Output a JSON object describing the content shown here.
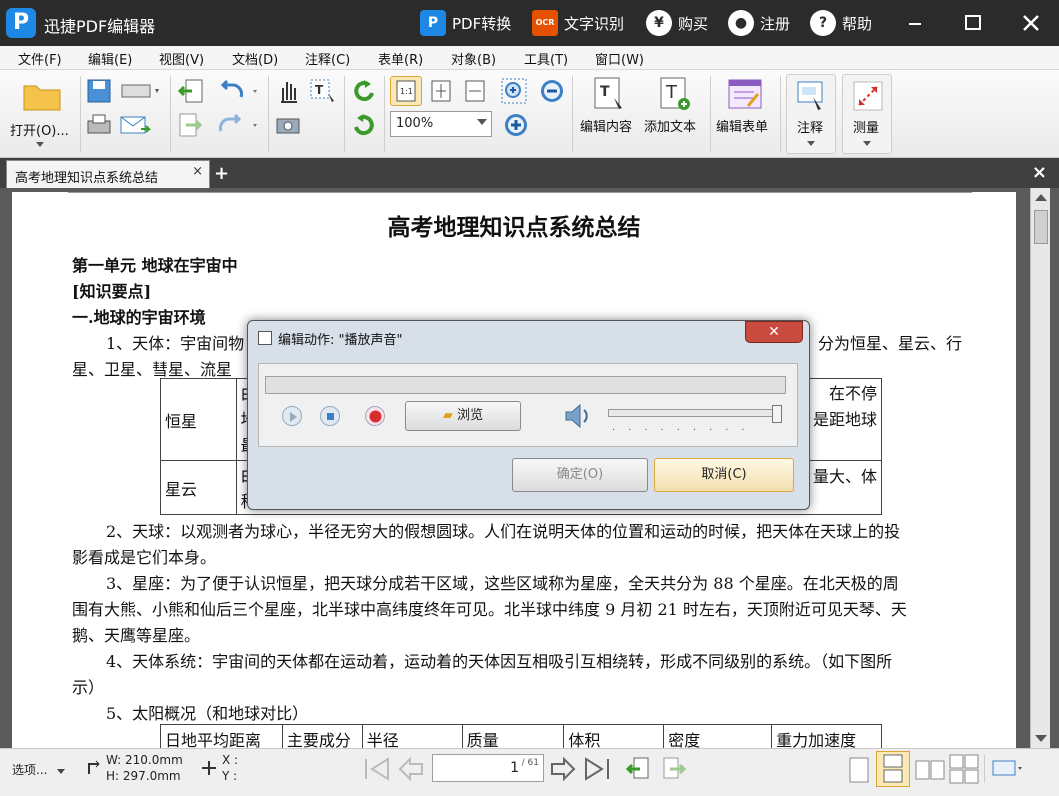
{
  "app": {
    "title": "迅捷PDF编辑器",
    "logo": "P"
  },
  "titlebar": {
    "pdf_convert": "PDF转换",
    "ocr": "文字识别",
    "ocr_badge": "OCR",
    "buy": "购买",
    "buy_icon": "¥",
    "register": "注册",
    "help": "帮助",
    "help_icon": "?"
  },
  "menu": [
    "文件(F)",
    "编辑(E)",
    "视图(V)",
    "文档(D)",
    "注释(C)",
    "表单(R)",
    "对象(B)",
    "工具(T)",
    "窗口(W)"
  ],
  "toolbar": {
    "open": "打开(O)...",
    "zoom": "100%",
    "edit_content": "编辑内容",
    "add_text": "添加文本",
    "edit_form": "编辑表单",
    "annotate": "注释",
    "measure": "测量"
  },
  "tab": {
    "label": "高考地理知识点系统总结",
    "close": "×",
    "add": "+",
    "viewer_close": "×"
  },
  "page": {
    "title": "高考地理知识点系统总结",
    "unit": "第一单元  地球在宇宙中",
    "key_points": "[知识要点]",
    "section": "一.地球的宇宙环境",
    "p1_start": "1、天体：宇宙间物",
    "p1_end": "分为恒星、星云、行",
    "p1_line2": "星、卫星、彗星、流星",
    "table1": {
      "row1_label": "恒星",
      "row1_left": [
        "由",
        "地",
        "最"
      ],
      "row1_right": [
        "在不停",
        "是距地球"
      ],
      "row2_label": "星云",
      "row2_left": [
        "由",
        "称"
      ],
      "row2_right": "量大、体"
    },
    "p2": "2、天球：以观测者为球心，半径无穷大的假想圆球。人们在说明天体的位置和运动的时候，把天体在天球上的投",
    "p2_line2": "影看成是它们本身。",
    "p3": "3、星座：为了便于认识恒星，把天球分成若干区域，这些区域称为星座，全天共分为 88 个星座。在北天极的周",
    "p3_line2": "围有大熊、小熊和仙后三个星座，北半球中高纬度终年可见。北半球中纬度 9 月初 21 时左右，天顶附近可见天琴、天",
    "p3_line3": "鹅、天鹰等星座。",
    "p4": "4、天体系统：宇宙间的天体都在运动着，运动着的天体因互相吸引互相绕转，形成不同级别的系统。（如下图所",
    "p4_line2": "示）",
    "p5": "5、太阳概况（和地球对比）",
    "table2_headers": [
      "日地平均距离",
      "主要成分",
      "半径",
      "质量",
      "体积",
      "密度",
      "重力加速度"
    ]
  },
  "dialog": {
    "title": "编辑动作: \"播放声音\"",
    "browse": "浏览",
    "ok": "确定(O)",
    "cancel": "取消(C)",
    "volume_level": 1.0
  },
  "status": {
    "options": "选项...",
    "width": "W: 210.0mm",
    "height": "H: 297.0mm",
    "x": "X :",
    "y": "Y :",
    "page_current": "1",
    "page_total": "/ 61"
  }
}
